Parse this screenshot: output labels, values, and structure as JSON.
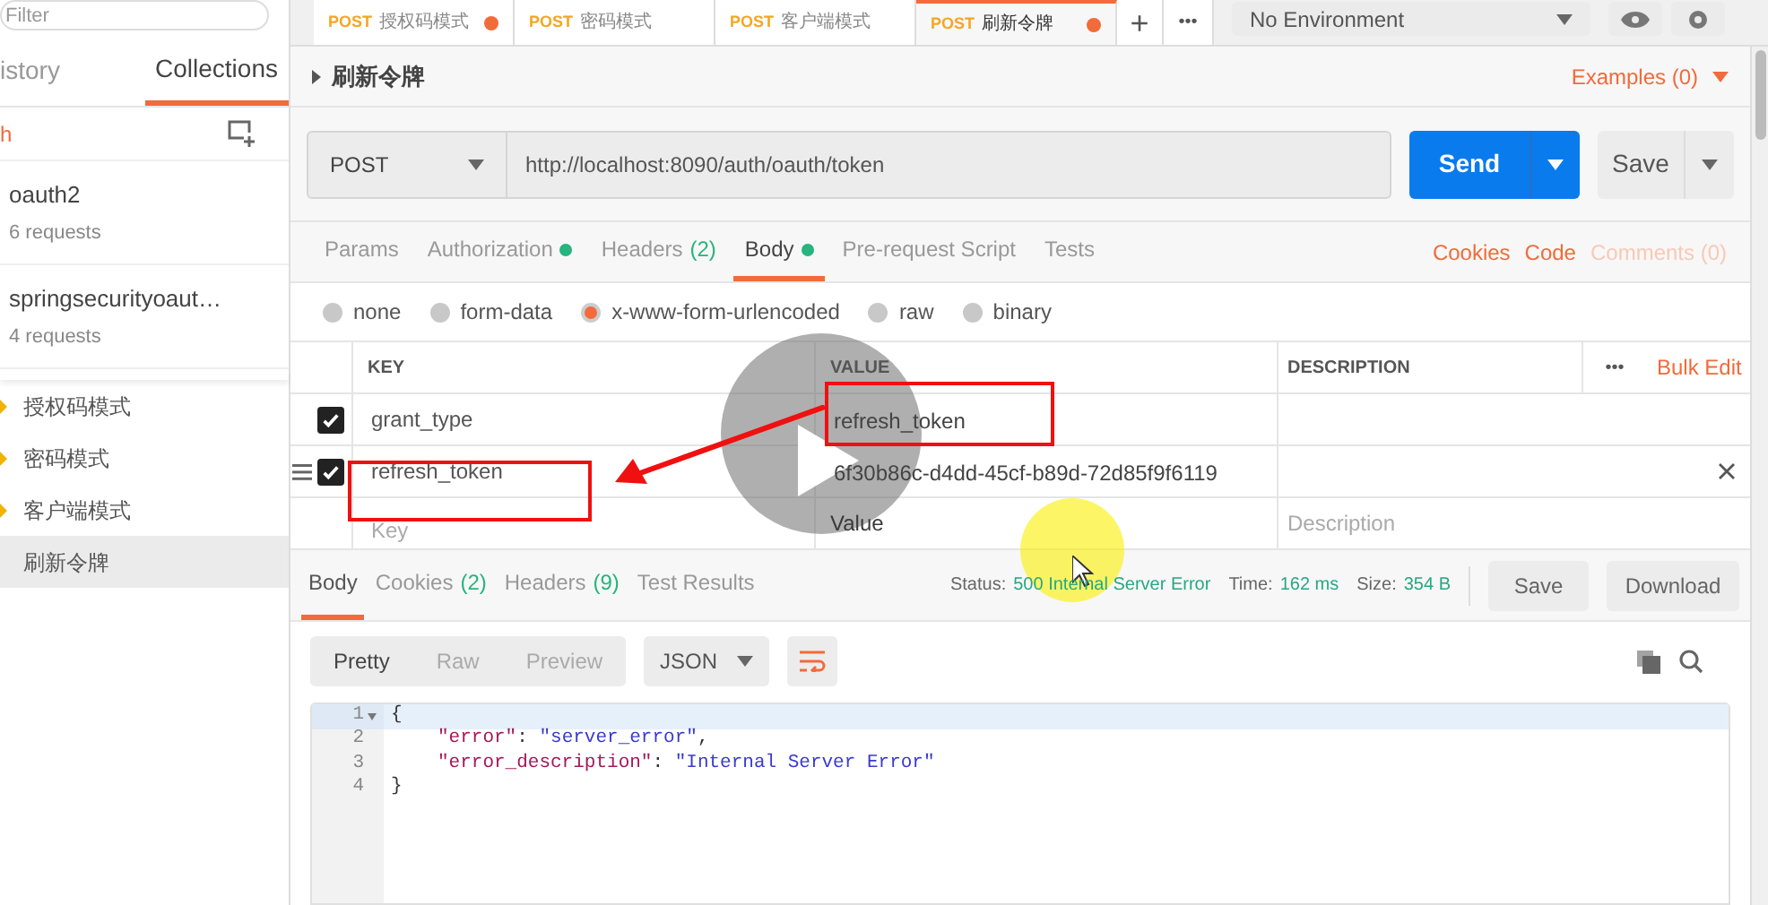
{
  "sidebar": {
    "filter": {
      "placeholder": "Filter"
    },
    "tabs": [
      {
        "label": "istory",
        "selected": false
      },
      {
        "label": "Collections",
        "selected": true
      }
    ],
    "trash_link": "h",
    "collections": [
      {
        "name": "oauth2",
        "count": "6 requests"
      },
      {
        "name": "springsecurityoaut…",
        "count": "4 requests"
      }
    ],
    "requests": [
      {
        "label": "授权码模式",
        "selected": false
      },
      {
        "label": "密码模式",
        "selected": false
      },
      {
        "label": "客户端模式",
        "selected": false
      },
      {
        "label": "刷新令牌",
        "selected": true
      }
    ]
  },
  "tabs": [
    {
      "method": "POST",
      "name": "授权码模式",
      "unsaved": true,
      "selected": false
    },
    {
      "method": "POST",
      "name": "密码模式",
      "unsaved": false,
      "selected": false
    },
    {
      "method": "POST",
      "name": "客户端模式",
      "unsaved": false,
      "selected": false
    },
    {
      "method": "POST",
      "name": "刷新令牌",
      "unsaved": true,
      "selected": true
    }
  ],
  "tab_actions": {
    "add": "+",
    "more": "•••"
  },
  "environment": {
    "value": "No Environment"
  },
  "request": {
    "title": "刷新令牌",
    "examples": "Examples (0)",
    "method": "POST",
    "url": "http://localhost:8090/auth/oauth/token",
    "send": "Send",
    "save": "Save"
  },
  "request_tabs": [
    {
      "label": "Params",
      "indicator": false,
      "selected": false
    },
    {
      "label": "Authorization",
      "indicator": true,
      "selected": false
    },
    {
      "label": "Headers",
      "count": "(2)",
      "indicator": false,
      "selected": false
    },
    {
      "label": "Body",
      "indicator": true,
      "selected": true
    },
    {
      "label": "Pre-request Script",
      "indicator": false,
      "selected": false
    },
    {
      "label": "Tests",
      "indicator": false,
      "selected": false
    }
  ],
  "request_links": [
    {
      "label": "Cookies",
      "disabled": false
    },
    {
      "label": "Code",
      "disabled": false
    },
    {
      "label": "Comments (0)",
      "disabled": true
    }
  ],
  "body_types": [
    {
      "label": "none",
      "selected": false
    },
    {
      "label": "form-data",
      "selected": false
    },
    {
      "label": "x-www-form-urlencoded",
      "selected": true
    },
    {
      "label": "raw",
      "selected": false
    },
    {
      "label": "binary",
      "selected": false
    }
  ],
  "params": {
    "columns": [
      "KEY",
      "VALUE",
      "DESCRIPTION"
    ],
    "more": "•••",
    "bulk_edit": "Bulk Edit",
    "rows": [
      {
        "key": "grant_type",
        "value": "refresh_token",
        "checked": true
      },
      {
        "key": "refresh_token",
        "value": "6f30b86c-d4dd-45cf-b89d-72d85f9f6119",
        "checked": true
      }
    ],
    "placeholder_row": {
      "key": "Key",
      "value": "Value",
      "description": "Description"
    }
  },
  "response": {
    "tabs": [
      {
        "label": "Body",
        "selected": true
      },
      {
        "label": "Cookies",
        "count": "(2)",
        "selected": false
      },
      {
        "label": "Headers",
        "count": "(9)",
        "selected": false
      },
      {
        "label": "Test Results",
        "selected": false
      }
    ],
    "status_label": "Status:",
    "status": "500 Internal Server Error",
    "time_label": "Time:",
    "time": "162 ms",
    "size_label": "Size:",
    "size": "354 B",
    "save": "Save",
    "download": "Download",
    "views": [
      {
        "label": "Pretty",
        "selected": true
      },
      {
        "label": "Raw",
        "selected": false
      },
      {
        "label": "Preview",
        "selected": false
      }
    ],
    "format": "JSON",
    "code": [
      {
        "number": "1",
        "foldable": true,
        "tokens": [
          {
            "kind": "punct",
            "text": "{"
          }
        ]
      },
      {
        "number": "2",
        "foldable": false,
        "tokens": [
          {
            "kind": "key",
            "text": "\"error\""
          },
          {
            "kind": "punct",
            "text": ": "
          },
          {
            "kind": "string",
            "text": "\"server_error\""
          },
          {
            "kind": "punct",
            "text": ","
          }
        ]
      },
      {
        "number": "3",
        "foldable": false,
        "tokens": [
          {
            "kind": "key",
            "text": "\"error_description\""
          },
          {
            "kind": "punct",
            "text": ": "
          },
          {
            "kind": "string",
            "text": "\"Internal Server Error\""
          }
        ]
      },
      {
        "number": "4",
        "foldable": false,
        "tokens": [
          {
            "kind": "punct",
            "text": "}"
          }
        ]
      }
    ]
  }
}
